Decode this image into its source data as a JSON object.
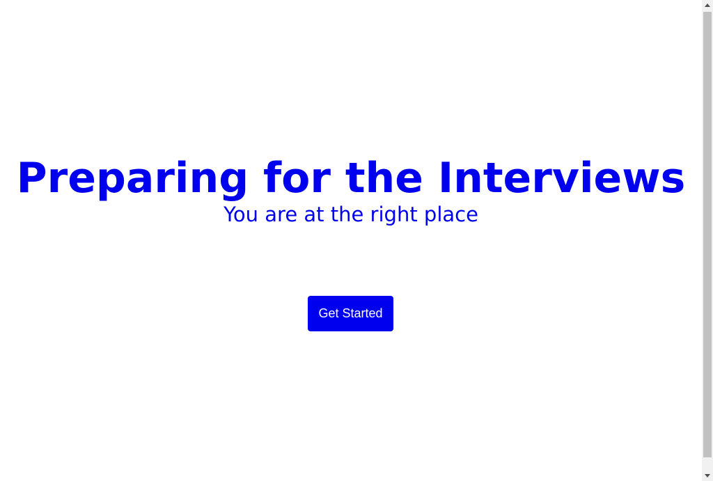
{
  "hero": {
    "title": "Preparing for the Interviews",
    "subtitle": "You are at the right place",
    "cta_label": "Get Started"
  },
  "colors": {
    "accent": "#0000ee",
    "background": "#ffffff",
    "button_text": "#ffffff",
    "scrollbar_track": "#f1f1f1",
    "scrollbar_thumb": "#c1c1c1"
  },
  "icons": {
    "scroll_up": "scroll-up-arrow-icon",
    "scroll_down": "scroll-down-arrow-icon"
  }
}
